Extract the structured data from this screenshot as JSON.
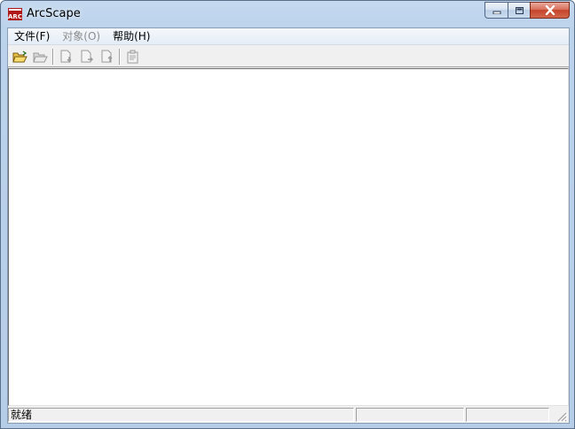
{
  "window": {
    "title": "ArcScape",
    "app_icon": "arc-app-icon",
    "icon_text": "ARC"
  },
  "caption_buttons": {
    "minimize": "minimize-icon",
    "maximize": "maximize-icon",
    "close": "close-icon"
  },
  "menu": {
    "items": [
      {
        "label": "文件(F)",
        "enabled": true
      },
      {
        "label": "对象(O)",
        "enabled": false
      },
      {
        "label": "帮助(H)",
        "enabled": true
      }
    ]
  },
  "toolbar": {
    "buttons": [
      {
        "icon": "open-folder-icon",
        "enabled": true
      },
      {
        "icon": "open-folder-icon",
        "enabled": false
      },
      {
        "icon": "document-import-icon",
        "enabled": false
      },
      {
        "icon": "document-export-icon",
        "enabled": false
      },
      {
        "icon": "document-upload-icon",
        "enabled": false
      },
      {
        "icon": "properties-icon",
        "enabled": false
      }
    ]
  },
  "status": {
    "text": "就绪",
    "pane2": "",
    "pane3": "",
    "pane4": ""
  },
  "colors": {
    "title_bar": "#bcd3ec",
    "close_button": "#c4432a",
    "workspace": "#ffffff",
    "chrome": "#f0f0f0",
    "disabled_text": "#8d8d8d"
  }
}
